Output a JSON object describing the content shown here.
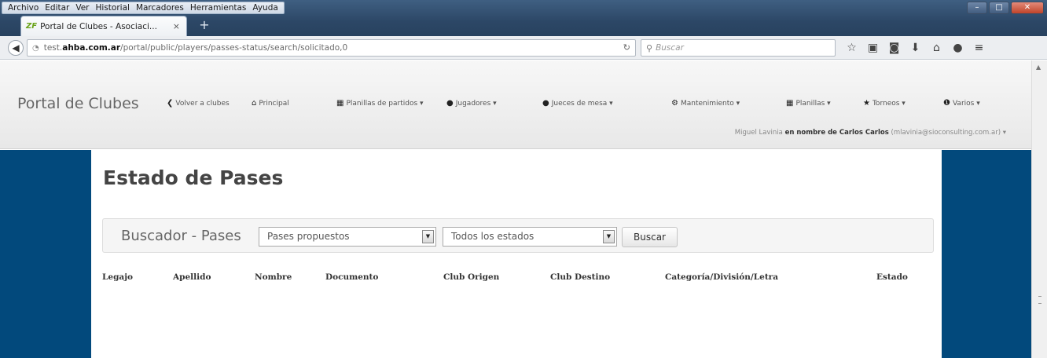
{
  "browser": {
    "menu": [
      "Archivo",
      "Editar",
      "Ver",
      "Historial",
      "Marcadores",
      "Herramientas",
      "Ayuda"
    ],
    "tab": {
      "icon": "zf-logo-icon",
      "title": "Portal de Clubes - Asociaci...",
      "close": "×"
    },
    "new_tab": "+",
    "url": {
      "prefix": "test.",
      "domain": "ahba.com.ar",
      "path": "/portal/public/players/passes-status/search/solicitado,0"
    },
    "search_placeholder": "Buscar",
    "toolbar_icons": [
      "star-icon",
      "clipboard-icon",
      "pocket-icon",
      "download-icon",
      "home-icon",
      "chat-icon",
      "menu-icon"
    ]
  },
  "header": {
    "brand": "Portal de Clubes",
    "nav": [
      {
        "icon": "chevron-left-icon",
        "label": "Volver a clubes"
      },
      {
        "icon": "home-icon",
        "label": "Principal"
      },
      {
        "icon": "table-icon",
        "label": "Planillas de partidos ▾"
      },
      {
        "icon": "user-icon",
        "label": "Jugadores ▾"
      },
      {
        "icon": "user-icon",
        "label": "Jueces de mesa ▾"
      },
      {
        "icon": "gear-icon",
        "label": "Mantenimiento ▾"
      },
      {
        "icon": "table-icon",
        "label": "Planillas ▾"
      },
      {
        "icon": "star-icon",
        "label": "Torneos ▾"
      },
      {
        "icon": "info-icon",
        "label": "Varios ▾"
      }
    ],
    "user": {
      "name": "Miguel Lavinia",
      "on_behalf": "en nombre de Carlos Carlos",
      "email": "(mlavinia@sioconsulting.com.ar)",
      "caret": "▾"
    }
  },
  "main": {
    "title": "Estado de Pases",
    "search": {
      "label": "Buscador - Pases",
      "type_select": "Pases propuestos",
      "status_select": "Todos los estados",
      "button": "Buscar"
    },
    "table_headers": [
      "Legajo",
      "Apellido",
      "Nombre",
      "Documento",
      "Club Origen",
      "Club Destino",
      "Categoría/División/Letra",
      "Estado"
    ]
  },
  "colors": {
    "sidebar": "#02497c",
    "titlebar": "#2c4766"
  }
}
